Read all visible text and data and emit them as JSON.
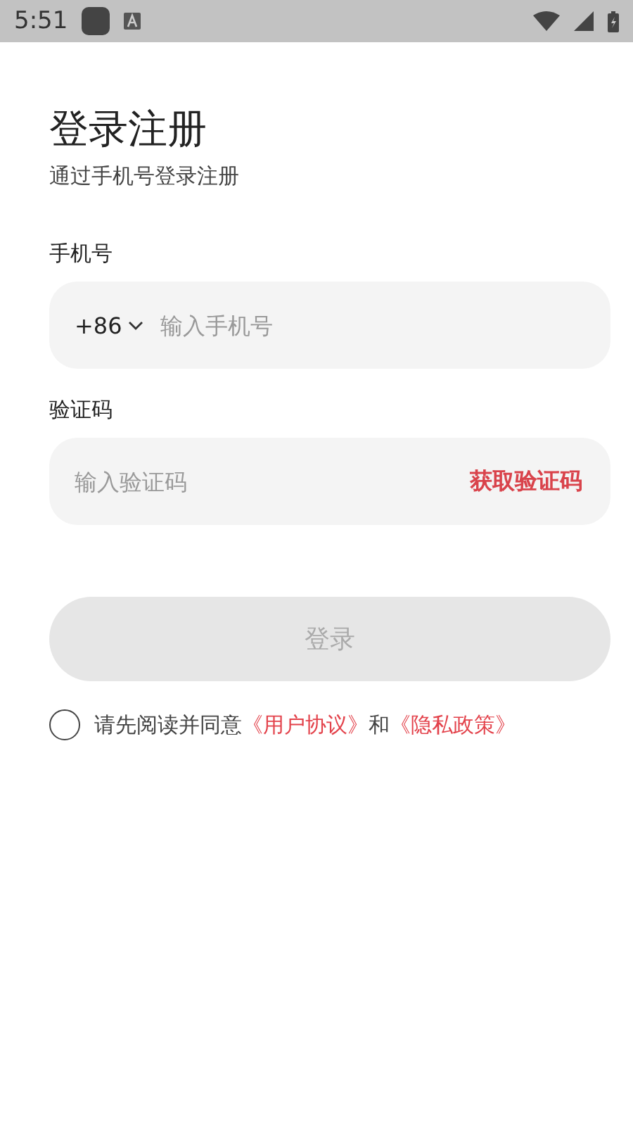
{
  "status_bar": {
    "time": "5:51"
  },
  "header": {
    "title": "登录注册",
    "subtitle": "通过手机号登录注册"
  },
  "phone": {
    "label": "手机号",
    "country_code": "+86",
    "placeholder": "输入手机号"
  },
  "code": {
    "label": "验证码",
    "placeholder": "输入验证码",
    "action": "获取验证码"
  },
  "login_button": {
    "label": "登录",
    "disabled": true
  },
  "agreement": {
    "checked": false,
    "parts": [
      {
        "kind": "text",
        "text": "请先阅读并同意"
      },
      {
        "kind": "link",
        "text": "《用户协议》"
      },
      {
        "kind": "text",
        "text": "和"
      },
      {
        "kind": "link",
        "text": "《隐私政策》"
      }
    ]
  }
}
